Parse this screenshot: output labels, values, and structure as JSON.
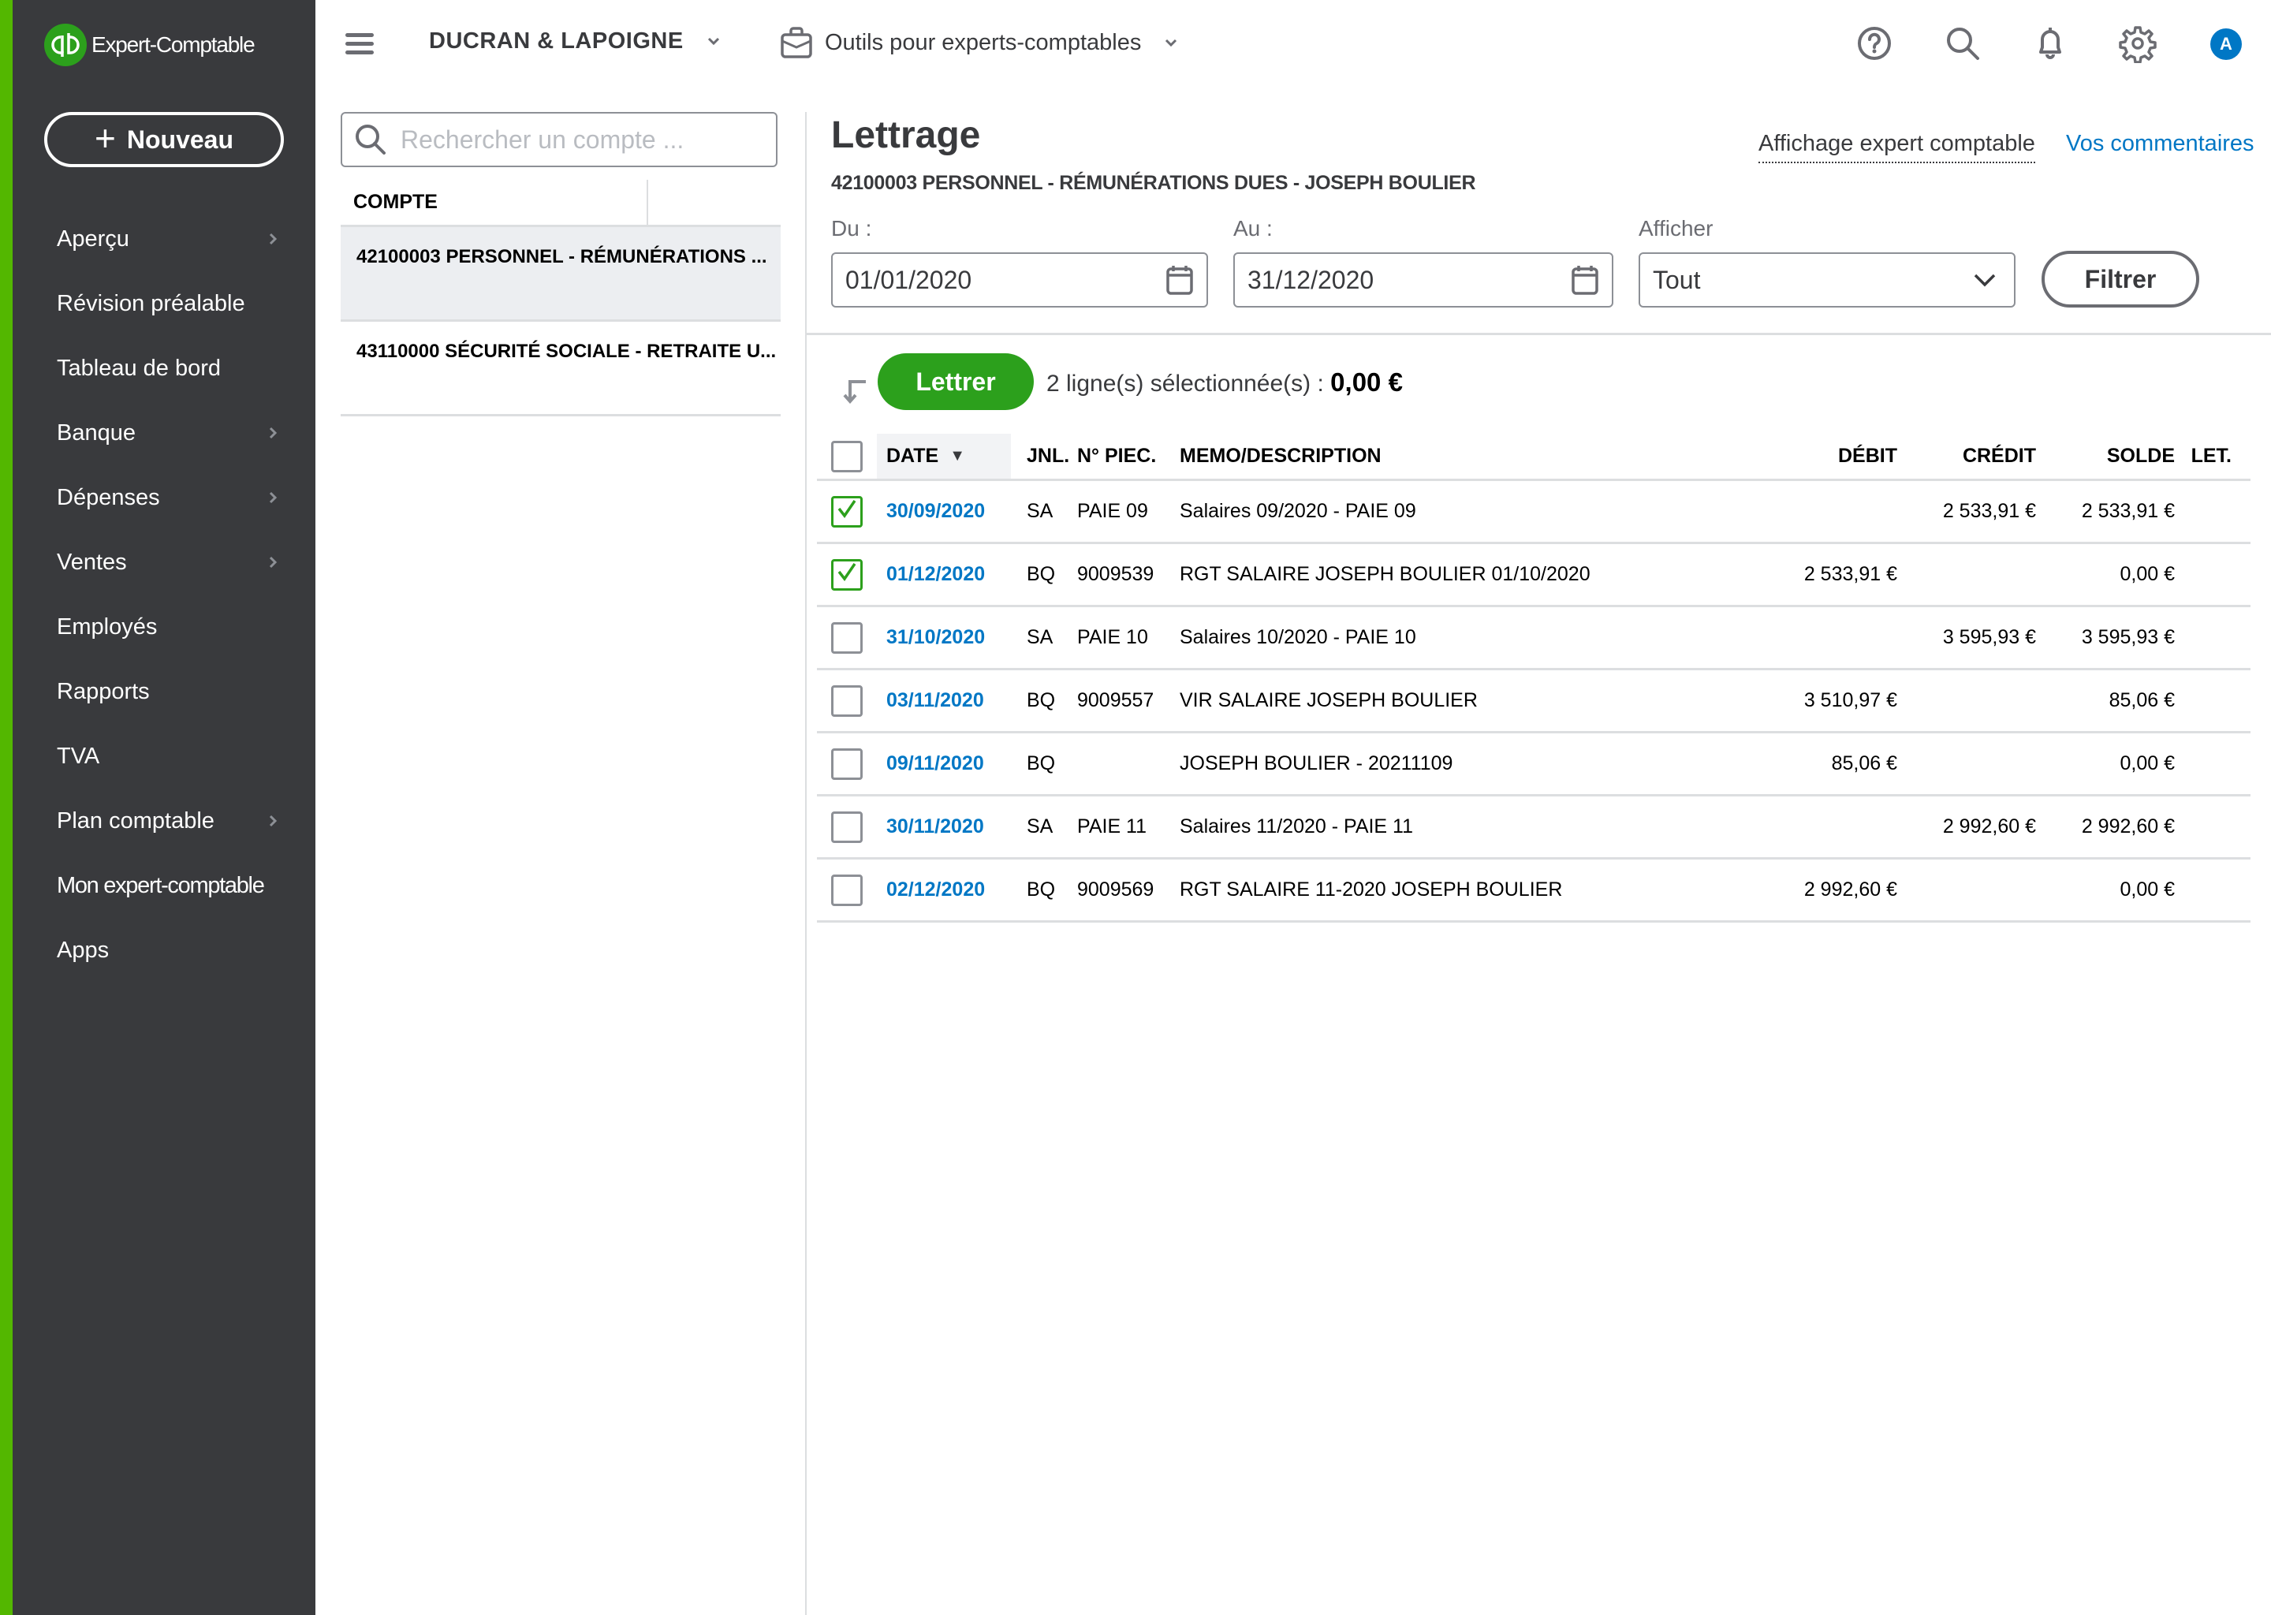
{
  "sidebar": {
    "brand": "Expert-Comptable",
    "new_button": "Nouveau",
    "accent_color": "#53b700",
    "items": [
      {
        "label": "Aperçu",
        "has_submenu": true
      },
      {
        "label": "Révision préalable",
        "has_submenu": false
      },
      {
        "label": "Tableau de bord",
        "has_submenu": false
      },
      {
        "label": "Banque",
        "has_submenu": true
      },
      {
        "label": "Dépenses",
        "has_submenu": true
      },
      {
        "label": "Ventes",
        "has_submenu": true
      },
      {
        "label": "Employés",
        "has_submenu": false
      },
      {
        "label": "Rapports",
        "has_submenu": false
      },
      {
        "label": "TVA",
        "has_submenu": false
      },
      {
        "label": "Plan comptable",
        "has_submenu": true
      },
      {
        "label": "Mon expert-comptable",
        "has_submenu": false
      },
      {
        "label": "Apps",
        "has_submenu": false
      }
    ]
  },
  "topbar": {
    "company": "DUCRAN & LAPOIGNE",
    "tools": "Outils pour experts-comptables",
    "icons": [
      "help-icon",
      "search-icon",
      "bell-icon",
      "gear-icon"
    ],
    "avatar_initial": "A"
  },
  "accounts": {
    "search_placeholder": "Rechercher un compte ...",
    "column_header": "COMPTE",
    "rows": [
      {
        "label": "42100003 PERSONNEL - RÉMUNÉRATIONS  ...",
        "selected": true
      },
      {
        "label": "43110000 SÉCURITÉ SOCIALE - RETRAITE U...",
        "selected": false
      }
    ]
  },
  "main": {
    "title": "Lettrage",
    "subtitle": "42100003 PERSONNEL - RÉMUNÉRATIONS DUES - JOSEPH BOULIER",
    "link_expert_view": "Affichage expert comptable",
    "link_feedback": "Vos commentaires",
    "filters": {
      "from_label": "Du :",
      "from_value": "01/01/2020",
      "to_label": "Au :",
      "to_value": "31/12/2020",
      "show_label": "Afficher",
      "show_value": "Tout",
      "filter_button": "Filtrer"
    },
    "action": {
      "lettrer_button": "Lettrer",
      "selection_text": "2 ligne(s) sélectionnée(s) :",
      "selection_total": "0,00 €"
    },
    "table": {
      "headers": {
        "date": "DATE",
        "jnl": "JNL.",
        "piece": "N° PIEC.",
        "memo": "MEMO/DESCRIPTION",
        "debit": "DÉBIT",
        "credit": "CRÉDIT",
        "solde": "SOLDE",
        "let": "LET."
      },
      "rows": [
        {
          "checked": true,
          "date": "30/09/2020",
          "jnl": "SA",
          "piece": "PAIE 09",
          "memo": "Salaires 09/2020 - PAIE 09",
          "debit": "",
          "credit": "2 533,91 €",
          "solde": "2 533,91 €",
          "let": ""
        },
        {
          "checked": true,
          "date": "01/12/2020",
          "jnl": "BQ",
          "piece": "9009539",
          "memo": "RGT SALAIRE JOSEPH BOULIER 01/10/2020",
          "debit": "2 533,91 €",
          "credit": "",
          "solde": "0,00 €",
          "let": ""
        },
        {
          "checked": false,
          "date": "31/10/2020",
          "jnl": "SA",
          "piece": "PAIE 10",
          "memo": "Salaires 10/2020 - PAIE 10",
          "debit": "",
          "credit": "3 595,93 €",
          "solde": "3 595,93 €",
          "let": ""
        },
        {
          "checked": false,
          "date": "03/11/2020",
          "jnl": "BQ",
          "piece": "9009557",
          "memo": "VIR SALAIRE JOSEPH BOULIER",
          "debit": "3 510,97 €",
          "credit": "",
          "solde": "85,06 €",
          "let": ""
        },
        {
          "checked": false,
          "date": "09/11/2020",
          "jnl": "BQ",
          "piece": "",
          "memo": "JOSEPH BOULIER - 20211109",
          "debit": "85,06 €",
          "credit": "",
          "solde": "0,00 €",
          "let": ""
        },
        {
          "checked": false,
          "date": "30/11/2020",
          "jnl": "SA",
          "piece": "PAIE 11",
          "memo": "Salaires 11/2020 - PAIE 11",
          "debit": "",
          "credit": "2 992,60 €",
          "solde": "2 992,60 €",
          "let": ""
        },
        {
          "checked": false,
          "date": "02/12/2020",
          "jnl": "BQ",
          "piece": "9009569",
          "memo": "RGT SALAIRE 11-2020 JOSEPH BOULIER",
          "debit": "2 992,60 €",
          "credit": "",
          "solde": "0,00 €",
          "let": ""
        }
      ]
    }
  },
  "colors": {
    "sidebar_bg": "#393a3d",
    "primary_green": "#2ca01c",
    "link_blue": "#0077c5"
  }
}
